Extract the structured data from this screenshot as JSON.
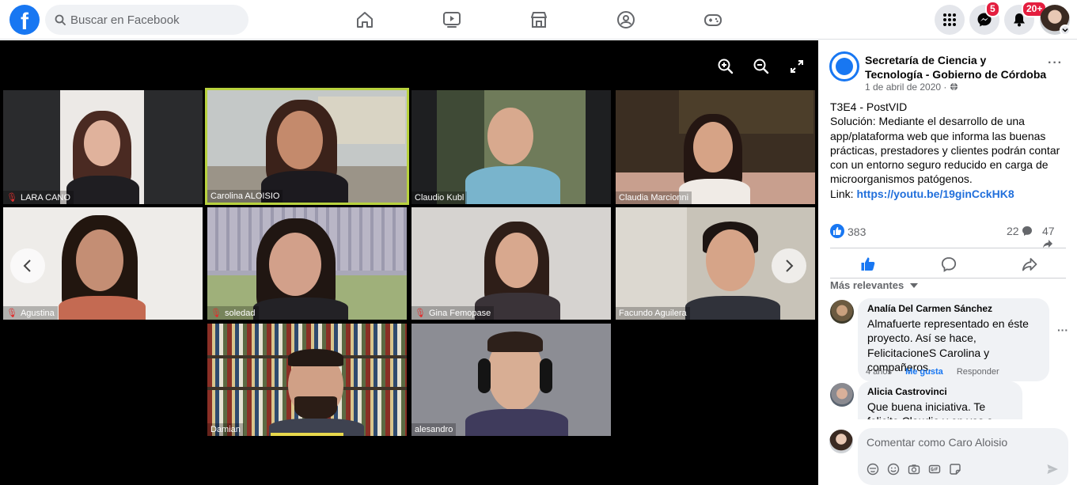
{
  "topbar": {
    "logo": "f",
    "search_placeholder": "Buscar en Facebook",
    "nav_icons": [
      "home-icon",
      "watch-icon",
      "marketplace-icon",
      "groups-icon",
      "gaming-icon"
    ],
    "messenger_badge": "5",
    "notifications_badge": "20+"
  },
  "viewer": {
    "tiles": [
      {
        "name": "LARA CANO",
        "muted": true
      },
      {
        "name": "Carolina ALOISIO",
        "muted": false,
        "active": true
      },
      {
        "name": "Claudio Kubl",
        "muted": false
      },
      {
        "name": "Claudia Marcionni",
        "muted": false
      },
      {
        "name": "Agustina",
        "muted": true
      },
      {
        "name": "soledad",
        "muted": true
      },
      {
        "name": "Gina Femopase",
        "muted": true
      },
      {
        "name": "Facundo Aguilera",
        "muted": false
      },
      {
        "name": "Damian",
        "muted": false
      },
      {
        "name": "alesandro",
        "muted": false
      }
    ]
  },
  "post": {
    "page_name": "Secretaría de Ciencia y Tecnología - Gobierno de Córdoba",
    "date": "1 de abril de 2020 ·",
    "more": "···",
    "line1": "T3E4 - PostVID",
    "line2": "Solución: Mediante el desarrollo de una app/plataforma web que informa las buenas prácticas, prestadores y clientes podrán contar con un entorno seguro reducido en carga de microorganismos patógenos.",
    "link_label": "Link: ",
    "link": "https://youtu.be/19ginCckHK8",
    "likes": "383",
    "comments_count": "22",
    "shares_count": "47",
    "sort_label": "Más relevantes"
  },
  "comments": [
    {
      "author": "Analía Del Carmen Sánchez",
      "text": "Almafuerte representado en éste proyecto. Así se hace, FelicitacioneS Carolina y compañeros.",
      "age": "4 años",
      "like": "Me gusta",
      "reply": "Responder"
    },
    {
      "author": "Alicia Castrovinci",
      "text": "Que buena iniciativa. Te felicito Claudio y en vos a todo el grupo"
    }
  ],
  "composer": {
    "placeholder": "Comentar como Caro Aloisio"
  }
}
